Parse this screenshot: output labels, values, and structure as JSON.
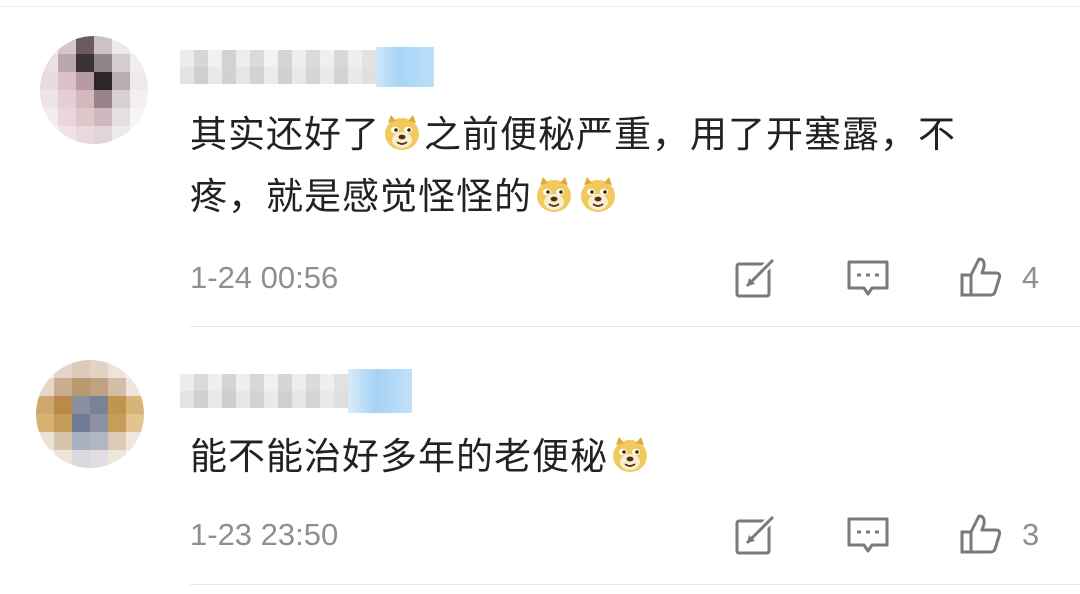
{
  "comments": [
    {
      "text_segments": [
        "其实还好了",
        "之前便秘严重，用了开塞露，不疼，就是感觉怪怪的"
      ],
      "emoji": "doge-emoji",
      "timestamp": "1-24 00:56",
      "like_count": "4"
    },
    {
      "text_segments": [
        "能不能治好多年的老便秘"
      ],
      "emoji": "doge-emoji",
      "timestamp": "1-23 23:50",
      "like_count": "3"
    }
  ],
  "icons": {
    "share": "share-icon",
    "reply": "comment-icon",
    "like": "thumbs-up-icon"
  },
  "colors": {
    "text": "#222222",
    "meta": "#8f8f8f",
    "icon": "#7a7a7a",
    "badge_blue": "#a8d4f5"
  }
}
